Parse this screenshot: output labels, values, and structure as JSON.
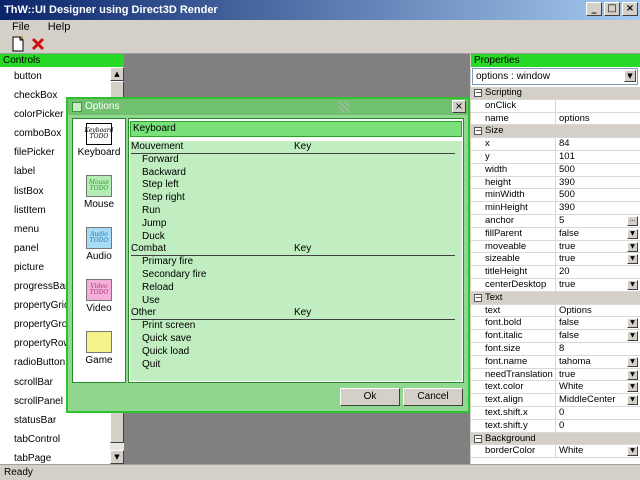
{
  "window": {
    "title": "ThW::UI Designer using Direct3D Render"
  },
  "menu": [
    "File",
    "Help"
  ],
  "controls_panel": {
    "title": "Controls",
    "items": [
      "button",
      "checkBox",
      "colorPicker",
      "comboBox",
      "filePicker",
      "label",
      "listBox",
      "listItem",
      "menu",
      "panel",
      "picture",
      "progressBar",
      "propertyGrid",
      "propertyGroup",
      "propertyRow",
      "radioButton",
      "scrollBar",
      "scrollPanel",
      "statusBar",
      "tabControl",
      "tabPage"
    ]
  },
  "properties_panel": {
    "title": "Properties",
    "selected": "options : window",
    "rows": [
      {
        "type": "cat",
        "name": "Scripting"
      },
      {
        "name": "onClick",
        "value": ""
      },
      {
        "name": "name",
        "value": "options"
      },
      {
        "type": "cat",
        "name": "Size"
      },
      {
        "name": "x",
        "value": "84"
      },
      {
        "name": "y",
        "value": "101"
      },
      {
        "name": "width",
        "value": "500"
      },
      {
        "name": "height",
        "value": "390"
      },
      {
        "name": "minWidth",
        "value": "500"
      },
      {
        "name": "minHeight",
        "value": "390"
      },
      {
        "name": "anchor",
        "value": "5",
        "ctl": "dots"
      },
      {
        "name": "fillParent",
        "value": "false",
        "ctl": "dd"
      },
      {
        "name": "moveable",
        "value": "true",
        "ctl": "dd"
      },
      {
        "name": "sizeable",
        "value": "true",
        "ctl": "dd"
      },
      {
        "name": "titleHeight",
        "value": "20"
      },
      {
        "name": "centerDesktop",
        "value": "true",
        "ctl": "dd"
      },
      {
        "type": "cat",
        "name": "Text"
      },
      {
        "name": "text",
        "value": "Options"
      },
      {
        "name": "font.bold",
        "value": "false",
        "ctl": "dd"
      },
      {
        "name": "font.italic",
        "value": "false",
        "ctl": "dd"
      },
      {
        "name": "font.size",
        "value": "8"
      },
      {
        "name": "font.name",
        "value": "tahoma",
        "ctl": "dd"
      },
      {
        "name": "needTranslation",
        "value": "true",
        "ctl": "dd"
      },
      {
        "name": "text.color",
        "value": "White",
        "ctl": "dd"
      },
      {
        "name": "text.align",
        "value": "MiddleCenter",
        "ctl": "dd"
      },
      {
        "name": "text.shift.x",
        "value": "0"
      },
      {
        "name": "text.shift.y",
        "value": "0"
      },
      {
        "type": "cat",
        "name": "Background"
      },
      {
        "name": "borderColor",
        "value": "White",
        "ctl": "dd"
      }
    ]
  },
  "status": "Ready",
  "dialog": {
    "title": "Options",
    "categories": [
      {
        "label": "Keyboard",
        "thumb": "Keyboard TODO",
        "selected": true,
        "color": "#ffffff",
        "text_color": "#000000"
      },
      {
        "label": "Mouse",
        "thumb": "Mouse TODO",
        "selected": false,
        "color": "#b6ecb6",
        "text_color": "#2e9e2e"
      },
      {
        "label": "Audio",
        "thumb": "Audio TODO",
        "selected": false,
        "color": "#a8dcf4",
        "text_color": "#2a7ab0"
      },
      {
        "label": "Video",
        "thumb": "Video TODO",
        "selected": false,
        "color": "#f4b0d8",
        "text_color": "#b03080"
      },
      {
        "label": "Game",
        "thumb": "",
        "selected": false,
        "color": "#f4f48c",
        "text_color": "#909020"
      }
    ],
    "section_title": "Keyboard",
    "key_groups": [
      {
        "name": "Mouvement",
        "key_header": "Key",
        "actions": [
          "Forward",
          "Backward",
          "Step left",
          "Step right",
          "Run",
          "Jump",
          "Duck"
        ]
      },
      {
        "name": "Combat",
        "key_header": "Key",
        "actions": [
          "Primary fire",
          "Secondary fire",
          "Reload",
          "Use"
        ]
      },
      {
        "name": "Other",
        "key_header": "Key",
        "actions": [
          "Print screen",
          "Quick save",
          "Quick load",
          "Quit"
        ]
      }
    ],
    "ok_label": "Ok",
    "cancel_label": "Cancel"
  }
}
